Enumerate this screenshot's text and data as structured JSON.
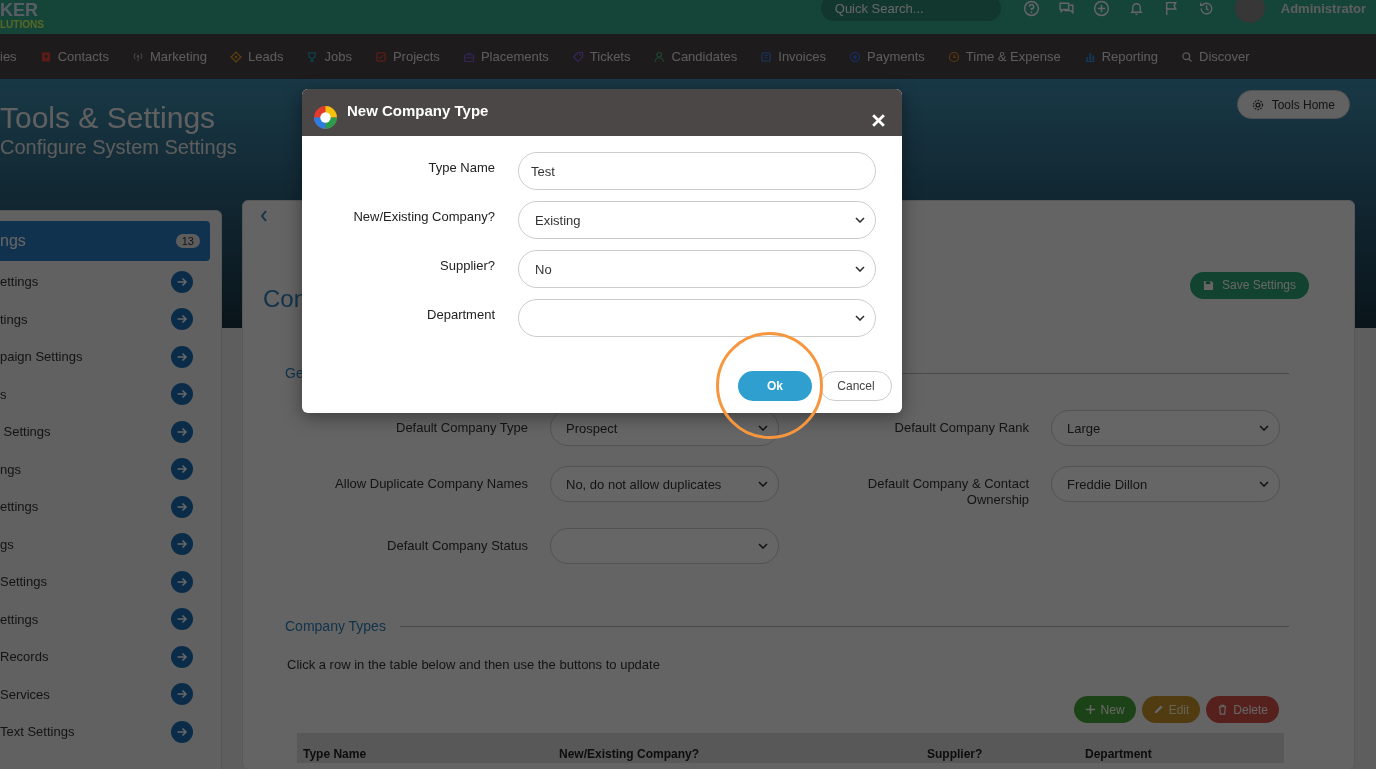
{
  "topbar": {
    "logo": "KER",
    "logo_tagline": "LUTIONS",
    "search": {
      "placeholder": "Quick Search..."
    },
    "user": "Administrator"
  },
  "nav": [
    {
      "label": "ies"
    },
    {
      "label": "Contacts",
      "kind": "card"
    },
    {
      "label": "Marketing",
      "kind": "signal"
    },
    {
      "label": "Leads",
      "kind": "diamond"
    },
    {
      "label": "Jobs",
      "kind": "trophy"
    },
    {
      "label": "Projects",
      "kind": "checkbox"
    },
    {
      "label": "Placements",
      "kind": "briefcase"
    },
    {
      "label": "Tickets",
      "kind": "tag"
    },
    {
      "label": "Candidates",
      "kind": "person"
    },
    {
      "label": "Invoices",
      "kind": "receipt"
    },
    {
      "label": "Payments",
      "kind": "coin"
    },
    {
      "label": "Time & Expense",
      "kind": "clock"
    },
    {
      "label": "Reporting",
      "kind": "bars"
    },
    {
      "label": "Discover",
      "kind": "search"
    }
  ],
  "header": {
    "title": "Tools & Settings",
    "subtitle": "Configure System Settings",
    "tools_home": "Tools Home"
  },
  "sidebar": {
    "title": "ngs",
    "count": "13",
    "items": [
      "ettings",
      "tings",
      "paign Settings",
      "s",
      " Settings",
      "ngs",
      "ettings",
      "gs",
      "Settings",
      "ettings",
      "Records",
      "Services",
      "Text Settings"
    ]
  },
  "card": {
    "heading": "Con",
    "save_button": "Save Settings",
    "section_title": "Ge",
    "fields": [
      {
        "label": "Default Company Type",
        "value": "Prospect"
      },
      {
        "label": "Default Company Rank",
        "value": "Large"
      },
      {
        "label": "Allow Duplicate Company Names",
        "value": "No, do not allow duplicates"
      },
      {
        "label": "Default Company & Contact Ownership",
        "value": "Freddie Dillon"
      },
      {
        "label": "Default Company Status"
      }
    ],
    "types_title": "Company Types",
    "instructions": "Click a row in the table below and then use the buttons to update",
    "buttons": [
      {
        "label": "New",
        "kind": "new",
        "disabled": false
      },
      {
        "label": "Edit",
        "kind": "edit",
        "disabled": true
      },
      {
        "label": "Delete",
        "kind": "delete",
        "disabled": false
      }
    ],
    "table": {
      "columns": [
        "Type Name",
        "New/Existing Company?",
        "Supplier?",
        "Department"
      ]
    }
  },
  "modal": {
    "title": "New Company Type",
    "fields": [
      {
        "label": "Type Name",
        "kind": "text",
        "value": "Test"
      },
      {
        "label": "New/Existing Company?",
        "kind": "select",
        "value": "Existing"
      },
      {
        "label": "Supplier?",
        "kind": "select",
        "value": "No"
      },
      {
        "label": "Department",
        "kind": "select"
      }
    ],
    "ok": "Ok",
    "cancel": "Cancel",
    "highlight_ok": true
  }
}
